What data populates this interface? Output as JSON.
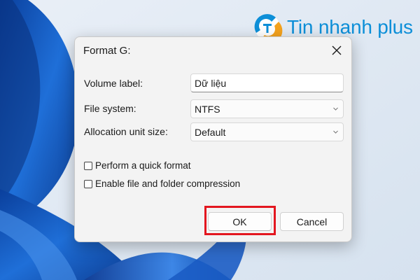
{
  "brand": {
    "logo_text": "Tin nhanh plus",
    "color": "#0d8fd8"
  },
  "dialog": {
    "title": "Format G:",
    "close_icon": "close-icon",
    "fields": {
      "volume_label": {
        "label": "Volume label:",
        "value": "Dữ liệu"
      },
      "file_system": {
        "label": "File system:",
        "value": "NTFS"
      },
      "allocation_unit_size": {
        "label": "Allocation unit size:",
        "value": "Default"
      }
    },
    "options": {
      "quick_format": {
        "label": "Perform a quick format",
        "checked": false
      },
      "compression": {
        "label": "Enable file and folder compression",
        "checked": false
      }
    },
    "buttons": {
      "ok": "OK",
      "cancel": "Cancel"
    },
    "highlight_color": "#e3161f"
  }
}
